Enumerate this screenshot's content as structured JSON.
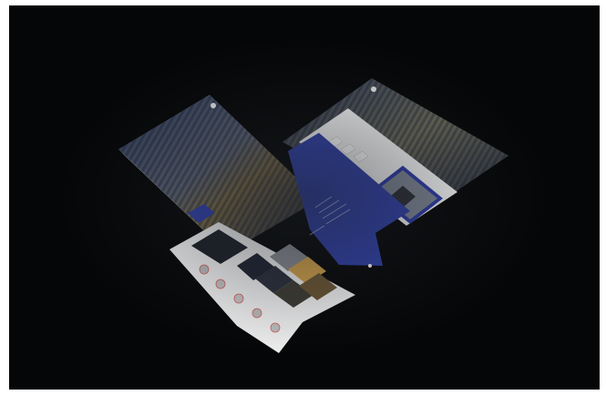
{
  "scene": {
    "background_color": "#050607",
    "accent_blue": "#3040a8",
    "page_white": "#f4f4f4"
  },
  "icons": {
    "logo": "circle-logo-icon",
    "portrait": "portrait-photo-icon",
    "arrow": "arrow-right-icon"
  }
}
